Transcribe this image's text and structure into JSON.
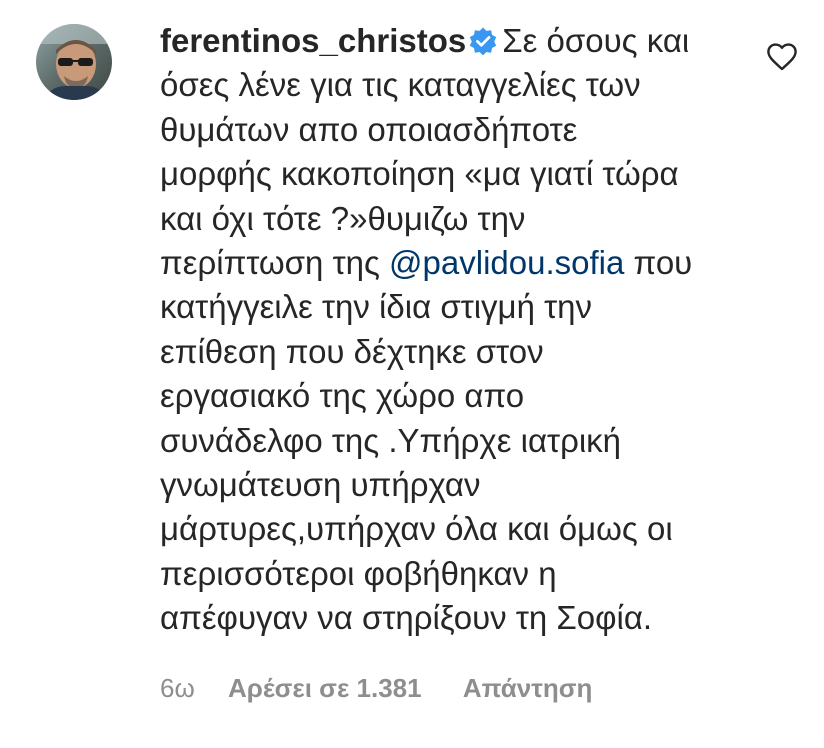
{
  "comment": {
    "username": "ferentinos_christos",
    "lines": [
      "Σε όσους και",
      "όσες λένε για τις καταγγελίες των",
      "θυμάτων απο οποιασδήποτε",
      "μορφής κακοποίηση «μα γιατί τώρα",
      "και όχι τότε ?»θυμιζω την",
      "περίπτωση της ",
      "@pavlidou.sofia",
      " που",
      "κατήγγειλε την ίδια στιγμή την",
      "επίθεση που δέχτηκε στον",
      "εργασιακό της χώρο απο",
      "συνάδελφο της .Υπήρχε ιατρική",
      "γνωμάτευση υπήρχαν",
      "μάρτυρες,υπήρχαν όλα και όμως οι",
      "περισσότεροι φοβήθηκαν η",
      "απέφυγαν να στηρίξουν τη Σοφία."
    ]
  },
  "meta": {
    "time": "6ω",
    "likes": "Αρέσει σε 1.381",
    "reply": "Απάντηση"
  },
  "icons": {
    "verified": "verified-badge-icon",
    "like": "heart-icon"
  },
  "colors": {
    "text": "#262626",
    "mention": "#00376b",
    "secondary": "#8e8e8e",
    "verified": "#3897f0"
  }
}
